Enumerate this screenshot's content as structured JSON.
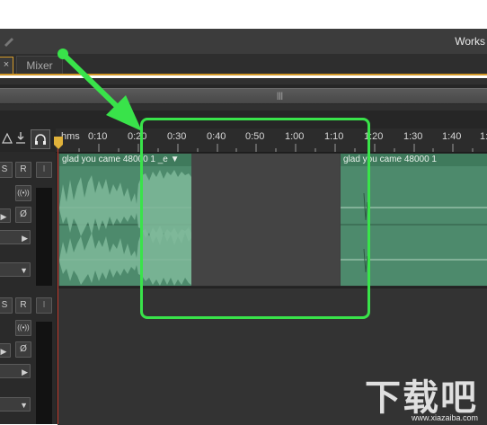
{
  "window": {
    "title": "Works"
  },
  "tabs": {
    "close_glyph": "×",
    "mixer_label": "Mixer"
  },
  "overview": {
    "grip_glyph": "|||"
  },
  "ruler": {
    "labels": [
      "hms",
      "0:10",
      "0:20",
      "0:30",
      "0:40",
      "0:50",
      "1:00",
      "1:10",
      "1:20",
      "1:30",
      "1:40",
      "1:"
    ]
  },
  "header_icons": [
    "triangle-icon",
    "download-icon",
    "headphones-icon"
  ],
  "track1": {
    "s_label": "S",
    "r_label": "R",
    "i_label": "I",
    "stereo_glyph": "((•))",
    "phase_glyph": "Ø",
    "play_glyph": "▶",
    "arrow_glyph": "▼",
    "clip1_title": "glad you came 48000 1  _e  ▼",
    "clip2_title": "glad you came 48000 1"
  },
  "track2": {
    "s_label": "S",
    "r_label": "R",
    "i_label": "I",
    "stereo_glyph": "((•))",
    "phase_glyph": "Ø",
    "play_glyph": "▶",
    "arrow_glyph": "▼"
  },
  "annotation": {
    "color": "#39e34a"
  },
  "colors": {
    "accent": "#d49a2a",
    "clip": "#4d8a6c",
    "playhead": "#c0392b"
  },
  "watermark": {
    "text": "下载吧",
    "sub": "www.xiazaiba.com"
  }
}
